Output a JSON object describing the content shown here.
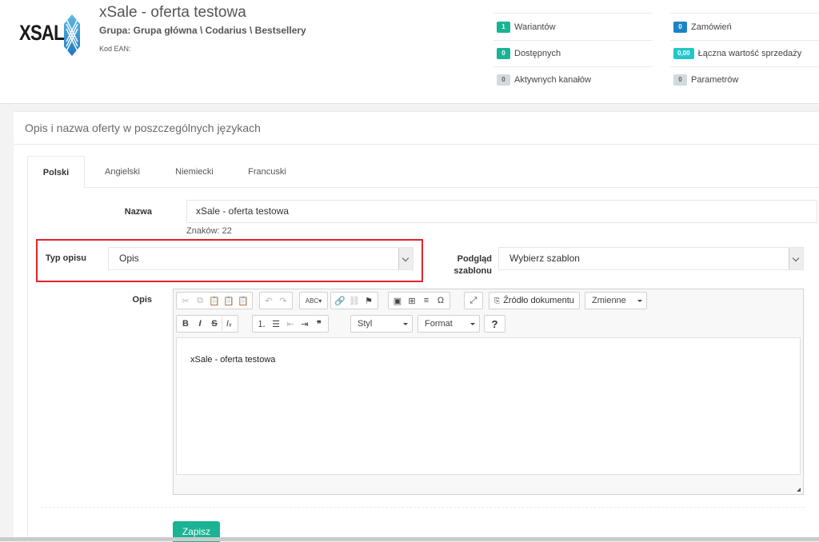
{
  "header": {
    "logo_text": "XSALE",
    "title": "xSale - oferta testowa",
    "group": "Grupa: Grupa główna \\ Codarius \\ Bestsellery",
    "ean_label": "Kod EAN:",
    "stats": [
      {
        "count": "1",
        "label": "Wariantów",
        "color": "#1ab394"
      },
      {
        "count": "0",
        "label": "Dostępnych",
        "color": "#1ab394"
      },
      {
        "count": "0",
        "label": "Aktywnych kanałów",
        "color": "#d1dade"
      },
      {
        "count": "0",
        "label": "Zamówień",
        "color": "#1c84c6"
      },
      {
        "count": "0,00",
        "label": "Łączna wartość sprzedaży",
        "color": "#23c6c8"
      },
      {
        "count": "0",
        "label": "Parametrów",
        "color": "#d1dade"
      }
    ]
  },
  "panel": {
    "title": "Opis i nazwa oferty w poszczególnych językach",
    "tabs": [
      "Polski",
      "Angielski",
      "Niemiecki",
      "Francuski"
    ],
    "active_tab": "Polski"
  },
  "form": {
    "name_label": "Nazwa",
    "name_value": "xSale - oferta testowa",
    "char_count": "Znaków: 22",
    "desc_type_label": "Typ opisu",
    "desc_type_value": "Opis",
    "preview_label_1": "Podgląd",
    "preview_label_2": "szablonu",
    "template_value": "Wybierz szablon",
    "desc_label": "Opis",
    "editor_content": "xSale - oferta testowa",
    "save_label": "Zapisz"
  },
  "editor_toolbar": {
    "source_label": "Źródło dokumentu",
    "variables_label": "Zmienne",
    "style_label": "Styl",
    "format_label": "Format",
    "help_label": "?"
  },
  "colors": {
    "accent": "#1ab394",
    "highlight_border": "#e0242b"
  }
}
